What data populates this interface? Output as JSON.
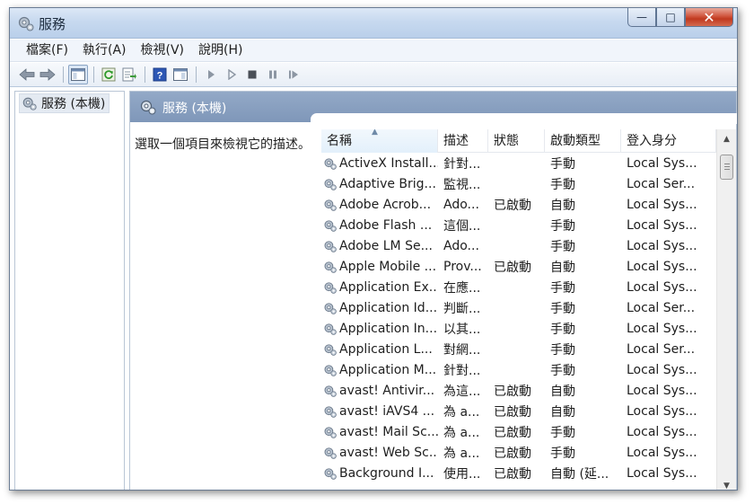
{
  "window": {
    "title": "服務",
    "caption": {
      "minimize": "—",
      "maximize": "□",
      "close": "✕"
    }
  },
  "menu": [
    {
      "label": "檔案(F)"
    },
    {
      "label": "執行(A)"
    },
    {
      "label": "檢視(V)"
    },
    {
      "label": "說明(H)"
    }
  ],
  "toolbar": {
    "buttons": [
      "back-icon",
      "forward-icon",
      "show-console-tree-icon",
      "refresh-icon",
      "export-list-icon",
      "help-icon",
      "properties-view-icon",
      "start-service-icon",
      "start-service-alt-icon",
      "stop-service-icon",
      "pause-service-icon",
      "resume-service-icon"
    ]
  },
  "tree": {
    "root_label": "服務 (本機)"
  },
  "right_pane": {
    "header": "服務 (本機)",
    "description": "選取一個項目來檢視它的描述。"
  },
  "list": {
    "columns": [
      "名稱",
      "描述",
      "狀態",
      "啟動類型",
      "登入身分"
    ],
    "sorted_column": "名稱",
    "rows": [
      {
        "name": "ActiveX Install...",
        "desc": "針對...",
        "status": "",
        "startup": "手動",
        "login": "Local Sys..."
      },
      {
        "name": "Adaptive Brig...",
        "desc": "監視...",
        "status": "",
        "startup": "手動",
        "login": "Local Ser..."
      },
      {
        "name": "Adobe Acrob...",
        "desc": "Ado...",
        "status": "已啟動",
        "startup": "自動",
        "login": "Local Sys..."
      },
      {
        "name": "Adobe Flash ...",
        "desc": "這個...",
        "status": "",
        "startup": "手動",
        "login": "Local Sys..."
      },
      {
        "name": "Adobe LM Se...",
        "desc": "Ado...",
        "status": "",
        "startup": "手動",
        "login": "Local Sys..."
      },
      {
        "name": "Apple Mobile ...",
        "desc": "Prov...",
        "status": "已啟動",
        "startup": "自動",
        "login": "Local Sys..."
      },
      {
        "name": "Application Ex...",
        "desc": "在應...",
        "status": "",
        "startup": "手動",
        "login": "Local Sys..."
      },
      {
        "name": "Application Id...",
        "desc": "判斷...",
        "status": "",
        "startup": "手動",
        "login": "Local Ser..."
      },
      {
        "name": "Application In...",
        "desc": "以其...",
        "status": "",
        "startup": "手動",
        "login": "Local Sys..."
      },
      {
        "name": "Application L...",
        "desc": "對網...",
        "status": "",
        "startup": "手動",
        "login": "Local Ser..."
      },
      {
        "name": "Application M...",
        "desc": "針對...",
        "status": "",
        "startup": "手動",
        "login": "Local Sys..."
      },
      {
        "name": "avast! Antivir...",
        "desc": "為這...",
        "status": "已啟動",
        "startup": "自動",
        "login": "Local Sys..."
      },
      {
        "name": "avast! iAVS4 ...",
        "desc": "為 a...",
        "status": "已啟動",
        "startup": "自動",
        "login": "Local Sys..."
      },
      {
        "name": "avast! Mail Sc...",
        "desc": "為 a...",
        "status": "已啟動",
        "startup": "手動",
        "login": "Local Sys..."
      },
      {
        "name": "avast! Web Sc...",
        "desc": "為 a...",
        "status": "已啟動",
        "startup": "手動",
        "login": "Local Sys..."
      },
      {
        "name": "Background I...",
        "desc": "使用...",
        "status": "已啟動",
        "startup": "自動 (延...",
        "login": "Local Sys..."
      }
    ]
  },
  "colors": {
    "titlebar": "#c7d9ef",
    "pane_header": "#8aa1c1",
    "close_button": "#c7452a",
    "selected_tree": "#e4eaf2"
  }
}
